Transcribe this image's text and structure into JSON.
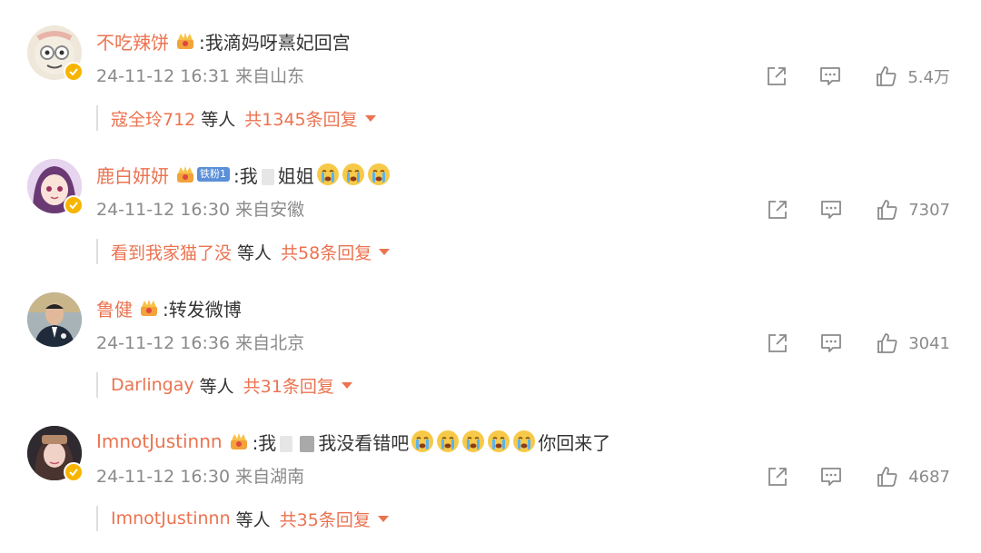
{
  "colors": {
    "username": "#eb7350",
    "text": "#333333",
    "meta": "#8a8a8a",
    "fan_badge": "#5b8fd9",
    "verified_badge": "#f7b500"
  },
  "icons": {
    "share": "share-icon",
    "comment": "comment-icon",
    "like": "like-icon",
    "crown": "crown-icon",
    "verified": "verified-icon",
    "emoji": "crying-emoji-icon",
    "expand": "caret-down-icon"
  },
  "comments": [
    {
      "username": "不吃辣饼",
      "text": ":我滴妈呀熹妃回宫",
      "meta": "24-11-12 16:31 来自山东",
      "likes": "5.4万",
      "reply_who": "寇全玲712",
      "reply_etc": "等人",
      "reply_total": "共1345条回复"
    },
    {
      "username": "鹿白妍妍",
      "fan_badge": "铁粉1",
      "text_a": ":我",
      "text_b": "姐姐",
      "meta": "24-11-12 16:30 来自安徽",
      "likes": "7307",
      "reply_who": "看到我家猫了没",
      "reply_etc": "等人",
      "reply_total": "共58条回复"
    },
    {
      "username": "鲁健",
      "text": ":转发微博",
      "meta": "24-11-12 16:36 来自北京",
      "likes": "3041",
      "reply_who": "Darlingay",
      "reply_etc": "等人",
      "reply_total": "共31条回复"
    },
    {
      "username": "ImnotJustinnn",
      "text_a": ":我",
      "text_b": "我没看错吧",
      "text_c": "你回来了",
      "meta": "24-11-12 16:30 来自湖南",
      "likes": "4687",
      "reply_who": "ImnotJustinnn",
      "reply_etc": "等人",
      "reply_total": "共35条回复"
    }
  ]
}
